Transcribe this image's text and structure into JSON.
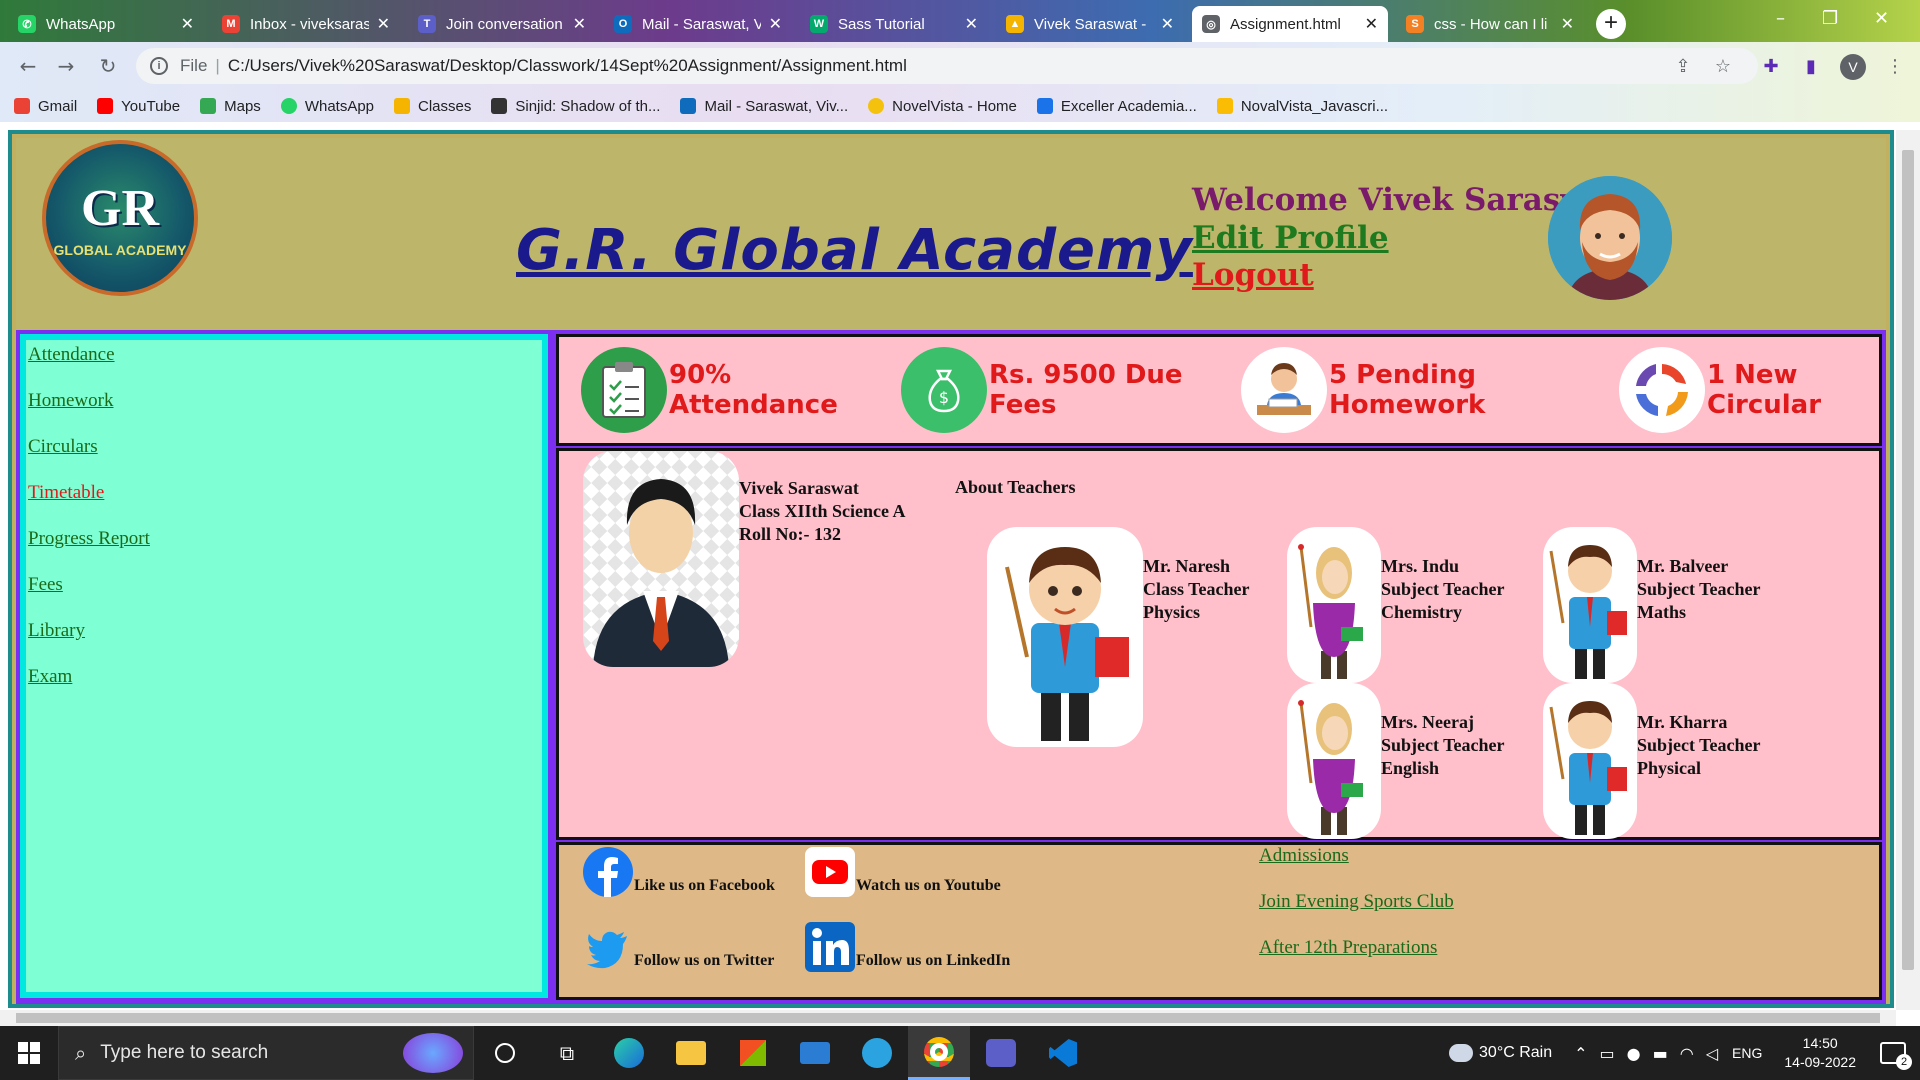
{
  "browser": {
    "tabs": [
      {
        "title": "WhatsApp",
        "icon_color": "#25d366",
        "icon_glyph": "✆"
      },
      {
        "title": "Inbox - viveksaras",
        "icon_color": "#ea4335",
        "icon_glyph": "M"
      },
      {
        "title": "Join conversation",
        "icon_color": "#5b5fc7",
        "icon_glyph": "T"
      },
      {
        "title": "Mail - Saraswat, V",
        "icon_color": "#0f6cbd",
        "icon_glyph": "O"
      },
      {
        "title": "Sass Tutorial",
        "icon_color": "#04aa6d",
        "icon_glyph": "W"
      },
      {
        "title": "Vivek Saraswat -",
        "icon_color": "#f4b400",
        "icon_glyph": "▲"
      },
      {
        "title": "Assignment.html",
        "icon_color": "#5f6368",
        "icon_glyph": "◎"
      },
      {
        "title": "css - How can I li",
        "icon_color": "#f48024",
        "icon_glyph": "S"
      }
    ],
    "active_tab_index": 6,
    "new_tab_glyph": "+",
    "url_protocol": "File",
    "url": "C:/Users/Vivek%20Saraswat/Desktop/Classwork/14Sept%20Assignment/Assignment.html",
    "profile_initial": "V",
    "bookmarks": [
      {
        "label": "Gmail",
        "color": "#ea4335"
      },
      {
        "label": "YouTube",
        "color": "#ff0000"
      },
      {
        "label": "Maps",
        "color": "#34a853"
      },
      {
        "label": "WhatsApp",
        "color": "#25d366"
      },
      {
        "label": "Classes",
        "color": "#f4b400"
      },
      {
        "label": "Sinjid: Shadow of th...",
        "color": "#333333"
      },
      {
        "label": "Mail - Saraswat, Viv...",
        "color": "#0f6cbd"
      },
      {
        "label": "NovelVista - Home",
        "color": "#f4c20d"
      },
      {
        "label": "Exceller Academia...",
        "color": "#1a73e8"
      },
      {
        "label": "NovalVista_Javascri...",
        "color": "#fbbc04"
      }
    ]
  },
  "header": {
    "logo_monogram": "GR",
    "logo_name": "GLOBAL ACADEMY",
    "school_title": "G.R. Global Academy",
    "welcome": "Welcome Vivek Saraswat!",
    "edit_profile": "Edit Profile",
    "logout": "Logout"
  },
  "sidebar": {
    "items": [
      {
        "label": "Attendance"
      },
      {
        "label": "Homework"
      },
      {
        "label": "Circulars"
      },
      {
        "label": "Timetable"
      },
      {
        "label": "Progress Report"
      },
      {
        "label": "Fees"
      },
      {
        "label": "Library"
      },
      {
        "label": "Exam"
      }
    ],
    "active_index": 3
  },
  "stats": [
    {
      "line1": "90%",
      "line2": "Attendance",
      "icon": "clipboard-icon"
    },
    {
      "line1": "Rs. 9500 Due",
      "line2": "Fees",
      "icon": "money-bag-icon"
    },
    {
      "line1": "5 Pending",
      "line2": "Homework",
      "icon": "student-studying-icon"
    },
    {
      "line1": "1 New",
      "line2": "Circular",
      "icon": "circular-arrows-icon"
    }
  ],
  "student": {
    "name": "Vivek Saraswat",
    "class": "Class XIIth Science A",
    "roll": "Roll No:- 132"
  },
  "about_teachers_heading": "About Teachers",
  "teachers": [
    {
      "name": "Mr. Naresh",
      "role": "Class Teacher",
      "subject": "Physics"
    },
    {
      "name": "Mrs. Indu",
      "role": "Subject Teacher",
      "subject": "Chemistry"
    },
    {
      "name": "Mr. Balveer",
      "role": "Subject Teacher",
      "subject": "Maths"
    },
    {
      "name": "Mrs. Neeraj",
      "role": "Subject Teacher",
      "subject": "English"
    },
    {
      "name": "Mr. Kharra",
      "role": "Subject Teacher",
      "subject": "Physical"
    }
  ],
  "footer": {
    "social": [
      {
        "label": "Like us on Facebook",
        "icon": "facebook-icon"
      },
      {
        "label": "Watch us on Youtube",
        "icon": "youtube-icon"
      },
      {
        "label": "Follow us on Twitter",
        "icon": "twitter-icon"
      },
      {
        "label": "Follow us on LinkedIn",
        "icon": "linkedin-icon"
      }
    ],
    "links": [
      {
        "label": "Admissions"
      },
      {
        "label": "Join Evening Sports Club"
      },
      {
        "label": "After 12th Preparations"
      }
    ]
  },
  "taskbar": {
    "search_placeholder": "Type here to search",
    "weather": "30°C  Rain",
    "language": "ENG",
    "time": "14:50",
    "date": "14-09-2022",
    "notification_count": "2"
  },
  "colors": {
    "header_bg": "#bdb56a",
    "sidebar_bg": "#7fffd4",
    "content_bg": "#ffc0cb",
    "footer_bg": "#deb887",
    "stat_text": "#e01a1a",
    "title": "#1a1a8c"
  }
}
